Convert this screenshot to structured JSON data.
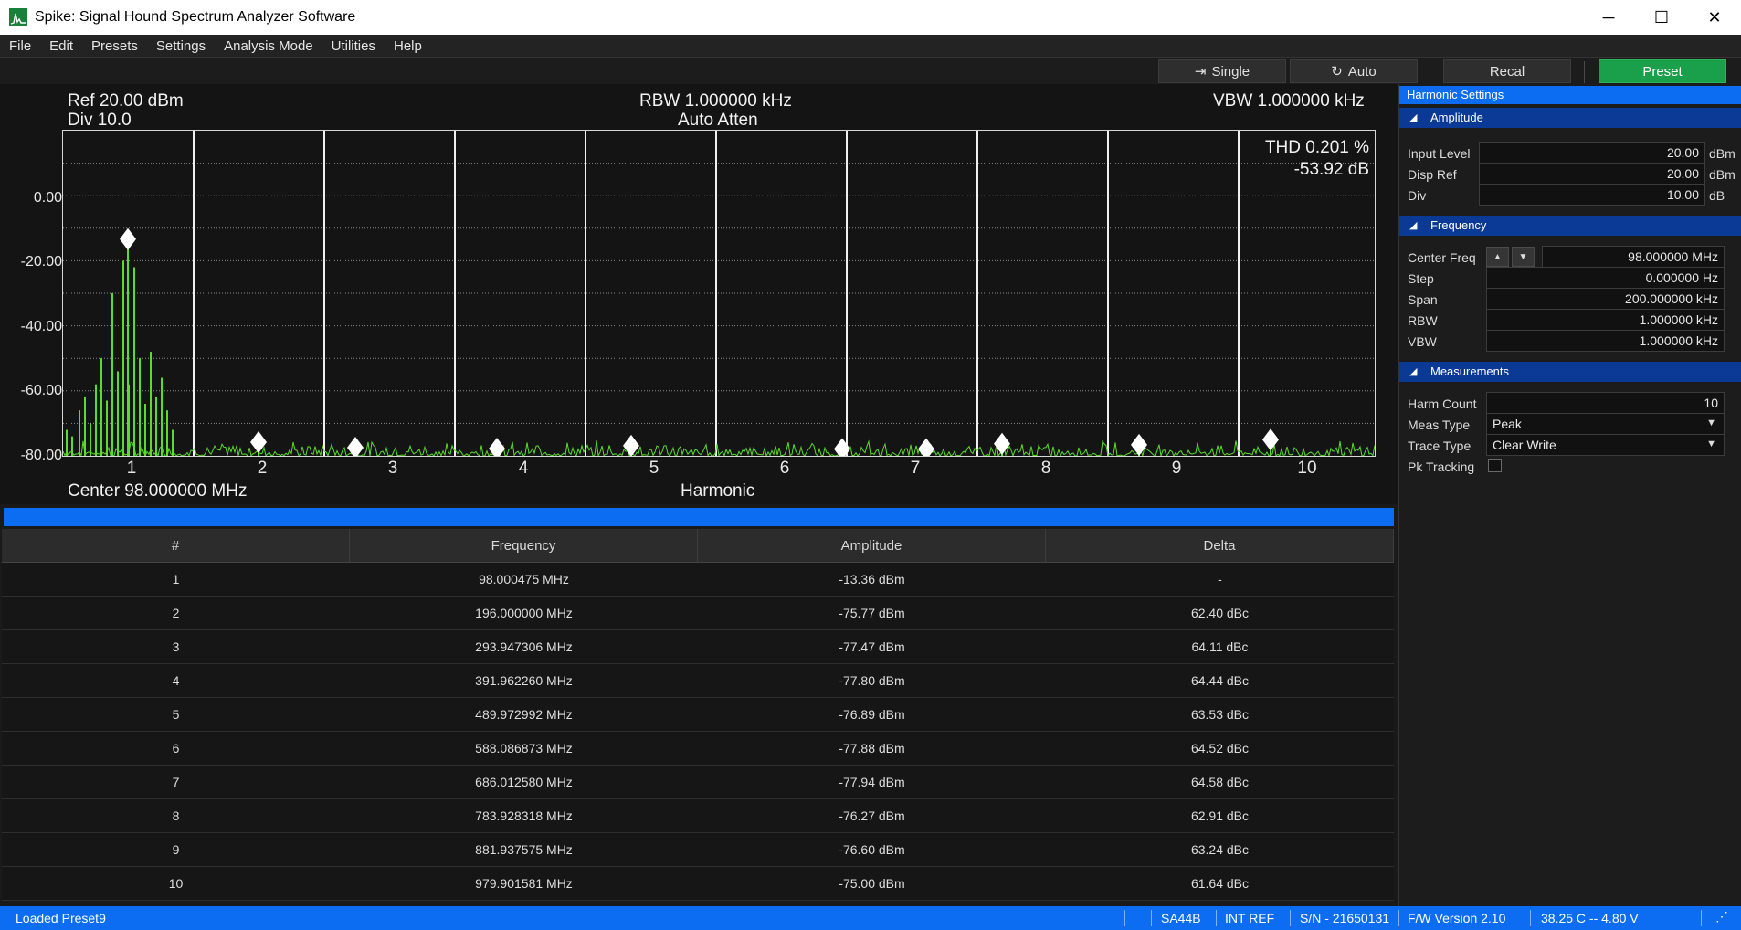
{
  "window": {
    "title": "Spike: Signal Hound Spectrum Analyzer Software",
    "controls": [
      "─",
      "☐",
      "✕"
    ]
  },
  "menu": [
    "File",
    "Edit",
    "Presets",
    "Settings",
    "Analysis Mode",
    "Utilities",
    "Help"
  ],
  "toolbar": {
    "single_label": "Single",
    "auto_label": "Auto",
    "recal_label": "Recal",
    "preset_label": "Preset",
    "preset_color": "#1aa04a"
  },
  "plot": {
    "ref": "Ref 20.00 dBm",
    "div": "Div 10.0",
    "rbw": "RBW 1.000000 kHz",
    "atten": "Auto Atten",
    "vbw": "VBW 1.000000 kHz",
    "thd_pct": "THD 0.201 %",
    "thd_db": "-53.92 dB",
    "center": "Center 98.000000 MHz",
    "xaxis_title": "Harmonic",
    "trace_color": "#5adc2a"
  },
  "chart_data": {
    "type": "line",
    "ylim": [
      -80,
      20
    ],
    "yticks": [
      "0.00",
      "-20.00",
      "-40.00",
      "-60.00",
      "-80.00"
    ],
    "yticks_values": [
      0,
      -20,
      -40,
      -60,
      -80
    ],
    "x_harmonics": [
      "1",
      "2",
      "3",
      "4",
      "5",
      "6",
      "7",
      "8",
      "9",
      "10"
    ],
    "marker_amplitudes_dbm": [
      -13.36,
      -75.77,
      -77.47,
      -77.8,
      -76.89,
      -77.88,
      -77.94,
      -76.27,
      -76.6,
      -75.0
    ],
    "grid": true
  },
  "table": {
    "headers": [
      "#",
      "Frequency",
      "Amplitude",
      "Delta"
    ],
    "rows": [
      [
        "1",
        "98.000475 MHz",
        "-13.36 dBm",
        "-"
      ],
      [
        "2",
        "196.000000 MHz",
        "-75.77 dBm",
        "62.40 dBc"
      ],
      [
        "3",
        "293.947306 MHz",
        "-77.47 dBm",
        "64.11 dBc"
      ],
      [
        "4",
        "391.962260 MHz",
        "-77.80 dBm",
        "64.44 dBc"
      ],
      [
        "5",
        "489.972992 MHz",
        "-76.89 dBm",
        "63.53 dBc"
      ],
      [
        "6",
        "588.086873 MHz",
        "-77.88 dBm",
        "64.52 dBc"
      ],
      [
        "7",
        "686.012580 MHz",
        "-77.94 dBm",
        "64.58 dBc"
      ],
      [
        "8",
        "783.928318 MHz",
        "-76.27 dBm",
        "62.91 dBc"
      ],
      [
        "9",
        "881.937575 MHz",
        "-76.60 dBm",
        "63.24 dBc"
      ],
      [
        "10",
        "979.901581 MHz",
        "-75.00 dBm",
        "61.64 dBc"
      ]
    ]
  },
  "side": {
    "title": "Harmonic Settings",
    "amplitude": {
      "header": "Amplitude",
      "input_level_label": "Input Level",
      "input_level": "20.00",
      "input_level_unit": "dBm",
      "disp_ref_label": "Disp Ref",
      "disp_ref": "20.00",
      "disp_ref_unit": "dBm",
      "div_label": "Div",
      "div": "10.00",
      "div_unit": "dB"
    },
    "frequency": {
      "header": "Frequency",
      "center_label": "Center Freq",
      "center": "98.000000 MHz",
      "step_label": "Step",
      "step": "0.000000 Hz",
      "span_label": "Span",
      "span": "200.000000 kHz",
      "rbw_label": "RBW",
      "rbw": "1.000000 kHz",
      "vbw_label": "VBW",
      "vbw": "1.000000 kHz"
    },
    "measurements": {
      "header": "Measurements",
      "harm_count_label": "Harm Count",
      "harm_count": "10",
      "meas_type_label": "Meas Type",
      "meas_type": "Peak",
      "trace_type_label": "Trace Type",
      "trace_type": "Clear Write",
      "pk_tracking_label": "Pk Tracking",
      "pk_tracking": false
    }
  },
  "status": {
    "message": "Loaded Preset9",
    "device": "SA44B",
    "ref": "INT REF",
    "serial": "S/N - 21650131",
    "fw": "F/W Version 2.10",
    "temp_volt": "38.25 C  --  4.80 V"
  }
}
